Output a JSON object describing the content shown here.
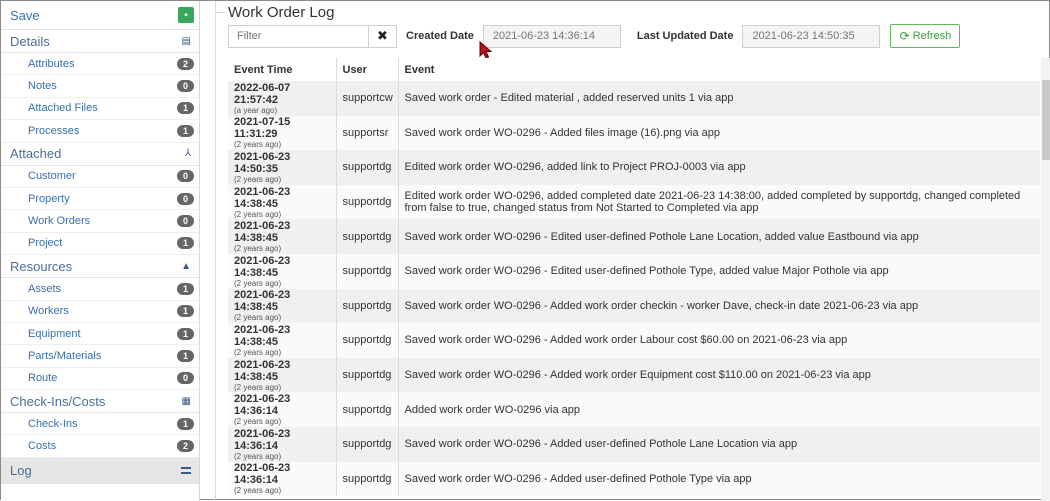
{
  "sidebar": {
    "save_label": "Save",
    "sections": [
      {
        "label": "Details",
        "icon": "table-icon",
        "items": [
          {
            "label": "Attributes",
            "count": "2"
          },
          {
            "label": "Notes",
            "count": "0"
          },
          {
            "label": "Attached Files",
            "count": "1"
          },
          {
            "label": "Processes",
            "count": "1"
          }
        ]
      },
      {
        "label": "Attached",
        "icon": "sitemap-icon",
        "items": [
          {
            "label": "Customer",
            "count": "0"
          },
          {
            "label": "Property",
            "count": "0"
          },
          {
            "label": "Work Orders",
            "count": "0"
          },
          {
            "label": "Project",
            "count": "1"
          }
        ]
      },
      {
        "label": "Resources",
        "icon": "road-icon",
        "items": [
          {
            "label": "Assets",
            "count": "1"
          },
          {
            "label": "Workers",
            "count": "1"
          },
          {
            "label": "Equipment",
            "count": "1"
          },
          {
            "label": "Parts/Materials",
            "count": "1"
          },
          {
            "label": "Route",
            "count": "0"
          }
        ]
      },
      {
        "label": "Check-Ins/Costs",
        "icon": "ledger-icon",
        "items": [
          {
            "label": "Check-Ins",
            "count": "1"
          },
          {
            "label": "Costs",
            "count": "2"
          }
        ]
      }
    ],
    "log_label": "Log"
  },
  "main": {
    "title": "Work Order Log",
    "filter_placeholder": "Filter",
    "created_label": "Created Date",
    "created_value": "2021-06-23 14:36:14",
    "updated_label": "Last Updated Date",
    "updated_value": "2021-06-23 14:50:35",
    "refresh_label": "Refresh"
  },
  "table": {
    "headers": [
      "Event Time",
      "User",
      "Event"
    ],
    "rows": [
      {
        "time": "2022-06-07 21:57:42",
        "ago": "(a year ago)",
        "user": "supportcw",
        "event": "Saved work order - Edited material , added reserved units 1 via app"
      },
      {
        "time": "2021-07-15 11:31:29",
        "ago": "(2 years ago)",
        "user": "supportsr",
        "event": "Saved work order WO-0296 - Added files image (16).png via app"
      },
      {
        "time": "2021-06-23 14:50:35",
        "ago": "(2 years ago)",
        "user": "supportdg",
        "event": "Edited work order WO-0296, added link to Project PROJ-0003 via app"
      },
      {
        "time": "2021-06-23 14:38:45",
        "ago": "(2 years ago)",
        "user": "supportdg",
        "event": "Edited work order WO-0296, added completed date 2021-06-23 14:38:00, added completed by supportdg, changed completed from false to true, changed status from Not Started to Completed via app"
      },
      {
        "time": "2021-06-23 14:38:45",
        "ago": "(2 years ago)",
        "user": "supportdg",
        "event": "Saved work order WO-0296 - Edited user-defined Pothole Lane Location, added value Eastbound via app"
      },
      {
        "time": "2021-06-23 14:38:45",
        "ago": "(2 years ago)",
        "user": "supportdg",
        "event": "Saved work order WO-0296 - Edited user-defined Pothole Type, added value Major Pothole via app"
      },
      {
        "time": "2021-06-23 14:38:45",
        "ago": "(2 years ago)",
        "user": "supportdg",
        "event": "Saved work order WO-0296 - Added work order checkin - worker Dave, check-in date 2021-06-23 via app"
      },
      {
        "time": "2021-06-23 14:38:45",
        "ago": "(2 years ago)",
        "user": "supportdg",
        "event": "Saved work order WO-0296 - Added work order Labour cost $60.00 on 2021-06-23 via app"
      },
      {
        "time": "2021-06-23 14:38:45",
        "ago": "(2 years ago)",
        "user": "supportdg",
        "event": "Saved work order WO-0296 - Added work order Equipment cost $110.00 on 2021-06-23 via app"
      },
      {
        "time": "2021-06-23 14:36:14",
        "ago": "(2 years ago)",
        "user": "supportdg",
        "event": "Added work order WO-0296 via app"
      },
      {
        "time": "2021-06-23 14:36:14",
        "ago": "(2 years ago)",
        "user": "supportdg",
        "event": "Saved work order WO-0296 - Added user-defined Pothole Lane Location via app"
      },
      {
        "time": "2021-06-23 14:36:14",
        "ago": "(2 years ago)",
        "user": "supportdg",
        "event": "Saved work order WO-0296 - Added user-defined Pothole Type via app"
      }
    ]
  },
  "colors": {
    "accent": "#3a6fa8",
    "save_green": "#3aa65a",
    "refresh_green": "#5cb85c",
    "badge": "#666666"
  }
}
